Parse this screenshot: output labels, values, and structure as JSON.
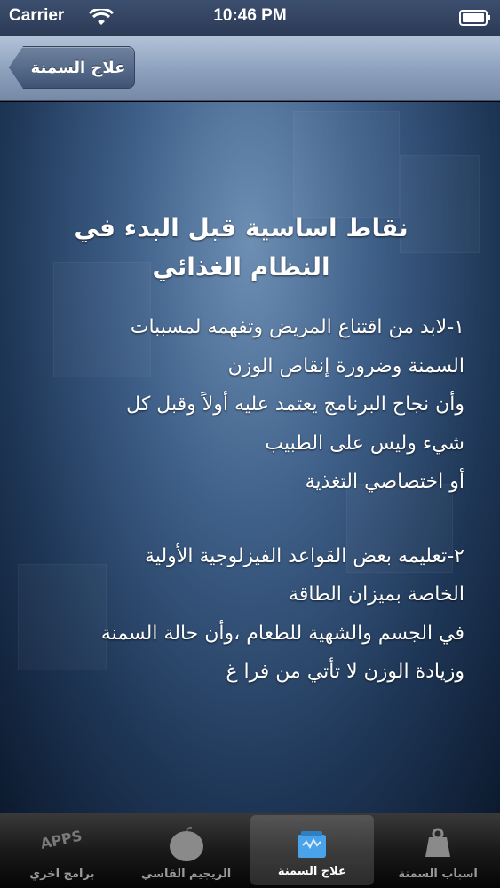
{
  "status_bar": {
    "carrier": "Carrier",
    "time": "10:46 PM"
  },
  "nav": {
    "back_label": "علاج السمنة"
  },
  "article": {
    "title": "نقاط اساسية قبل البدء في النظام الغذائي",
    "section1": [
      "١-لابد من اقتناع المريض وتفهمه لمسببات",
      "السمنة وضرورة إنقاص الوزن",
      "وأن نجاح البرنامج يعتمد عليه أولاً وقبل كل",
      "شيء وليس على الطبيب",
      "أو اختصاصي التغذية"
    ],
    "section2": [
      "٢-تعليمه بعض القواعد الفيزلوجية الأولية",
      "الخاصة بميزان الطاقة",
      "في الجسم والشهية للطعام ،وأن حالة السمنة",
      "وزيادة الوزن لا تأتي من فرا غ"
    ]
  },
  "tab_bar": {
    "tabs": [
      {
        "label": "برامج اخري",
        "icon": "apps-icon",
        "selected": false
      },
      {
        "label": "الريجيم القاسي",
        "icon": "apple-icon",
        "selected": false
      },
      {
        "label": "علاج السمنة",
        "icon": "scale-icon",
        "selected": true
      },
      {
        "label": "اسباب السمنة",
        "icon": "weight-icon",
        "selected": false
      }
    ],
    "apps_icon_text": "APPS"
  }
}
